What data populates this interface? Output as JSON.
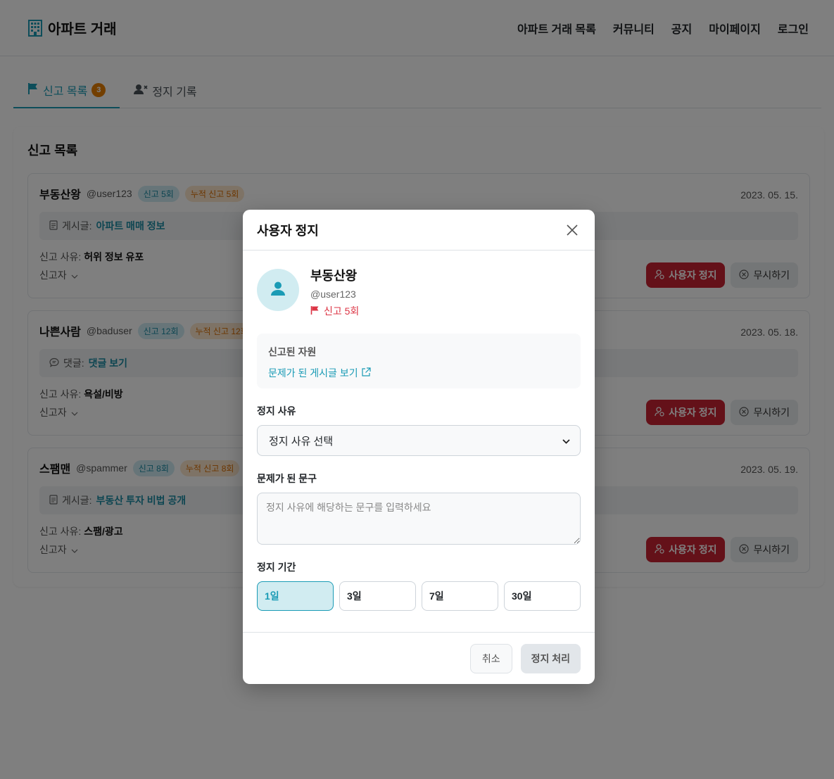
{
  "header": {
    "brand": "아파트 거래",
    "nav": [
      "아파트 거래 목록",
      "커뮤니티",
      "공지",
      "마이페이지",
      "로그인"
    ]
  },
  "tabs": [
    {
      "label": "신고 목록",
      "count": "3"
    },
    {
      "label": "정지 기록"
    }
  ],
  "panel": {
    "title": "신고 목록",
    "reports": [
      {
        "name": "부동산왕",
        "handle": "@user123",
        "report_badge": "신고 5회",
        "total_badge": "누적 신고 5회",
        "date": "2023. 05. 15.",
        "target_type": "게시글:",
        "target_title": "아파트 매매 정보",
        "reason_label": "신고 사유:",
        "reason": "허위 정보 유포",
        "reporter_label": "신고자",
        "suspend_label": "사용자 정지",
        "ignore_label": "무시하기"
      },
      {
        "name": "나쁜사람",
        "handle": "@baduser",
        "report_badge": "신고 12회",
        "total_badge": "누적 신고 12회",
        "date": "2023. 05. 18.",
        "target_type": "댓글:",
        "target_title": "댓글 보기",
        "reason_label": "신고 사유:",
        "reason": "욕설/비방",
        "reporter_label": "신고자",
        "suspend_label": "사용자 정지",
        "ignore_label": "무시하기"
      },
      {
        "name": "스팸맨",
        "handle": "@spammer",
        "report_badge": "신고 8회",
        "total_badge": "누적 신고 8회",
        "date": "2023. 05. 19.",
        "target_type": "게시글:",
        "target_title": "부동산 투자 비법 공개",
        "reason_label": "신고 사유:",
        "reason": "스팸/광고",
        "reporter_label": "신고자",
        "suspend_label": "사용자 정지",
        "ignore_label": "무시하기"
      }
    ]
  },
  "modal": {
    "title": "사용자 정지",
    "user": {
      "name": "부동산왕",
      "handle": "@user123",
      "report_count": "신고 5회"
    },
    "resource": {
      "label": "신고된 자원",
      "link": "문제가 된 게시글 보기"
    },
    "reason": {
      "label": "정지 사유",
      "selected": "정지 사유 선택"
    },
    "phrase": {
      "label": "문제가 된 문구",
      "placeholder": "정지 사유에 해당하는 문구를 입력하세요"
    },
    "duration": {
      "label": "정지 기간",
      "options": [
        "1일",
        "3일",
        "7일",
        "30일"
      ],
      "selected": "1일"
    },
    "cancel_label": "취소",
    "confirm_label": "정지 처리"
  },
  "colors": {
    "accent": "#1a9bb5",
    "danger": "#c82333",
    "badge_orange": "#e67e00",
    "overlay": "rgba(0,0,0,0.5)"
  }
}
